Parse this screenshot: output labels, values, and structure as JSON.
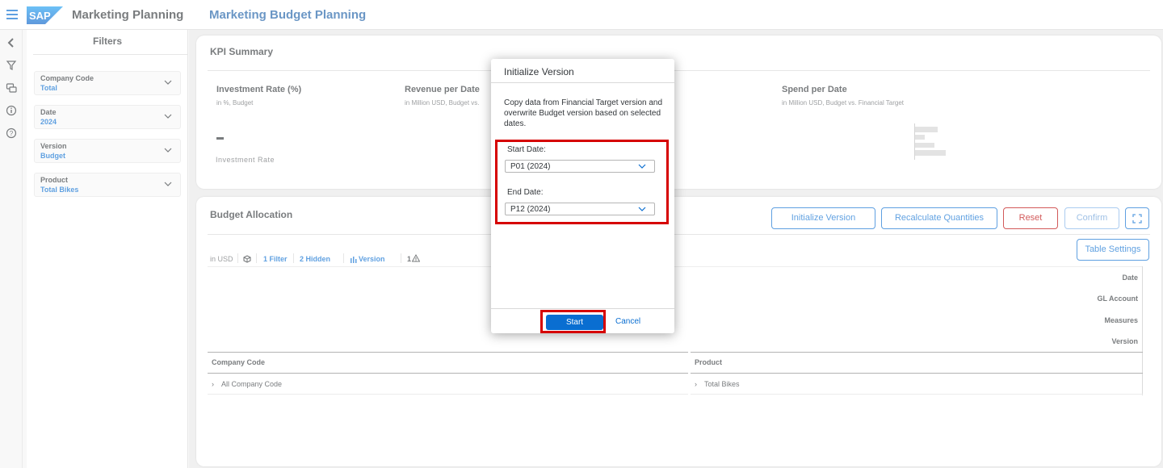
{
  "shell": {
    "app_title": "Marketing Planning",
    "page_title": "Marketing Budget Planning",
    "logo_text": "SAP"
  },
  "filters": {
    "title": "Filters",
    "items": [
      {
        "label": "Company Code",
        "value": "Total"
      },
      {
        "label": "Date",
        "value": "2024"
      },
      {
        "label": "Version",
        "value": "Budget"
      },
      {
        "label": "Product",
        "value": "Total Bikes"
      }
    ]
  },
  "kpi": {
    "title": "KPI Summary",
    "tiles": [
      {
        "title": "Investment Rate (%)",
        "subtitle": "in %, Budget"
      },
      {
        "title": "Revenue per Date",
        "subtitle": "in Million USD, Budget vs."
      },
      {
        "title": "Spend per Date",
        "subtitle": "in Million USD, Budget vs. Financial Target"
      }
    ],
    "investment_value": "–",
    "investment_label": "Investment Rate"
  },
  "budget": {
    "title": "Budget Allocation",
    "buttons": {
      "initialize": "Initialize Version",
      "recalculate": "Recalculate Quantities",
      "reset": "Reset",
      "confirm": "Confirm",
      "table_settings": "Table Settings"
    },
    "toolbar": {
      "unit": "in USD",
      "filter": "1 Filter",
      "hidden": "2 Hidden",
      "version": "Version",
      "warnings": "1"
    },
    "row_headers": [
      "Date",
      "GL Account",
      "Measures",
      "Version"
    ],
    "columns": [
      "Company Code",
      "Product"
    ],
    "rows": [
      {
        "company": "All Company Code",
        "product": "Total Bikes"
      }
    ]
  },
  "dialog": {
    "title": "Initialize Version",
    "message": "Copy data from Financial Target version and overwrite Budget version based on selected dates.",
    "start_label": "Start Date:",
    "start_value": "P01 (2024)",
    "end_label": "End Date:",
    "end_value": "P12 (2024)",
    "start_button": "Start",
    "cancel_button": "Cancel"
  },
  "colors": {
    "accent": "#0a6ed1",
    "highlight": "#d60000",
    "reset": "#bb0000"
  }
}
